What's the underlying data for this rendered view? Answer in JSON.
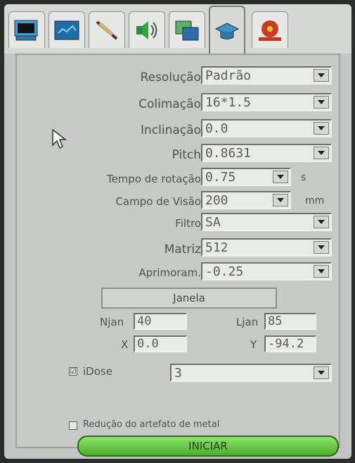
{
  "form": {
    "resolucao": {
      "label": "Resolução",
      "value": "Padrão"
    },
    "colimacao": {
      "label": "Colimação",
      "value": "16*1.5"
    },
    "inclinacao": {
      "label": "Inclinação",
      "value": "0.0"
    },
    "pitch": {
      "label": "Pitch",
      "value": "0.8631"
    },
    "tempo": {
      "label": "Tempo de rotação",
      "value": "0.75",
      "unit": "s"
    },
    "campo": {
      "label": "Campo de Visão",
      "value": "200",
      "unit": "mm"
    },
    "filtro": {
      "label": "Filtro",
      "value": "SA"
    },
    "matriz": {
      "label": "Matriz",
      "value": "512"
    },
    "aprimoram": {
      "label": "Aprimoram.",
      "value": "-0.25"
    }
  },
  "janela": {
    "title": "Janela",
    "njan_label": "Njan",
    "njan": "40",
    "ljan_label": "Ljan",
    "ljan": "85",
    "x_label": "X",
    "x": "0.0",
    "y_label": "Y",
    "y": "-94.2"
  },
  "idose": {
    "label": "iDose",
    "value": "3",
    "checked": "☑"
  },
  "metal": {
    "label": "Redução do artefato de metal",
    "checked": ""
  },
  "start": {
    "label": "INICIAR"
  }
}
